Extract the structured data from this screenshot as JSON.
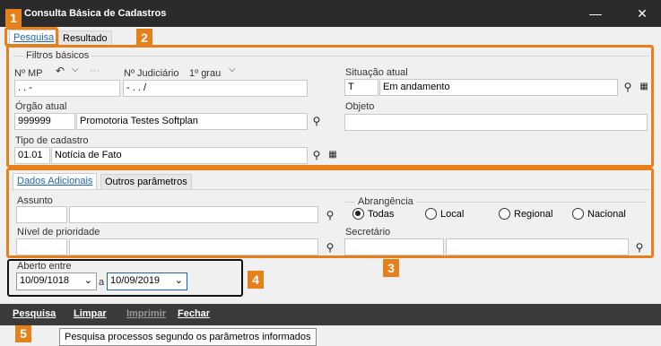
{
  "window": {
    "title": "Consulta Básica de Cadastros",
    "minimize": "—",
    "maximize": "☐",
    "close": "✕"
  },
  "tabs": {
    "search": "Pesquisa",
    "result": "Resultado"
  },
  "badges": [
    "1",
    "2",
    "3",
    "4",
    "5"
  ],
  "basic_filters": {
    "group_title": "Filtros básicos",
    "mp_label": "Nº MP",
    "mp_value": ".      .      -",
    "judicial_label": "Nº Judiciário",
    "degree_label": "1º grau",
    "judicial_value": "-      .      .      /",
    "status_label": "Situação atual",
    "status_code": "T",
    "status_desc": "Em andamento",
    "organ_label": "Órgão atual",
    "organ_code": "999999",
    "organ_desc": "Promotoria Testes Softplan",
    "object_label": "Objeto",
    "object_value": "",
    "type_label": "Tipo de cadastro",
    "type_code": "01.01",
    "type_desc": "Notícia de Fato"
  },
  "sub_tabs": {
    "additional": "Dados Adicionais",
    "other": "Outros parâmetros"
  },
  "additional": {
    "subject_label": "Assunto",
    "scope_label": "Abrangência",
    "scope_options": [
      "Todas",
      "Local",
      "Regional",
      "Nacional"
    ],
    "scope_selected": "Todas",
    "priority_label": "Nível de prioridade",
    "secretary_label": "Secretário"
  },
  "date_range": {
    "label": "Aberto entre",
    "from": "10/09/1018",
    "connector": "a",
    "to": "10/09/2019"
  },
  "footer": {
    "search": "Pesquisa",
    "clear": "Limpar",
    "print": "Imprimir",
    "close": "Fechar"
  },
  "tooltip": "Pesquisa processos segundo os parâmetros informados"
}
